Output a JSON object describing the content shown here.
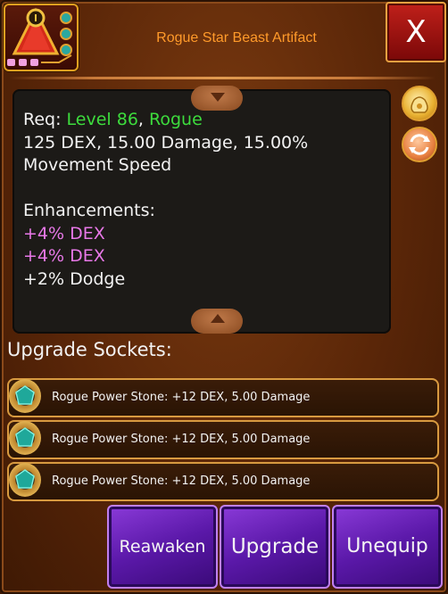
{
  "header": {
    "title": "Rogue Star Beast Artifact",
    "close_label": "X"
  },
  "description": {
    "req_label": "Req:",
    "level": "Level 86",
    "class": "Rogue",
    "stats_line1": "125 DEX, 15.00 Damage, 15.00%",
    "stats_line2": "Movement Speed",
    "enhancements_label": "Enhancements:",
    "enhancements": [
      "+4% DEX",
      "+4% DEX",
      "+2% Dodge"
    ]
  },
  "sockets": {
    "title": "Upgrade Sockets:",
    "items": [
      "Rogue Power Stone: +12 DEX, 5.00 Damage",
      "Rogue Power Stone: +12 DEX, 5.00 Damage",
      "Rogue Power Stone: +12 DEX, 5.00 Damage"
    ]
  },
  "actions": {
    "reawaken": "Reawaken",
    "upgrade": "Upgrade",
    "unequip": "Unequip"
  },
  "colors": {
    "title": "#ff9a2a",
    "requirement": "#3ddc3d",
    "enhancement": "#e878e8",
    "button": "#6a22b8"
  },
  "icons": {
    "item": "artifact-icon",
    "side_top": "coin-bag-icon",
    "side_bottom": "swap-icon",
    "socket": "power-stone-icon"
  }
}
